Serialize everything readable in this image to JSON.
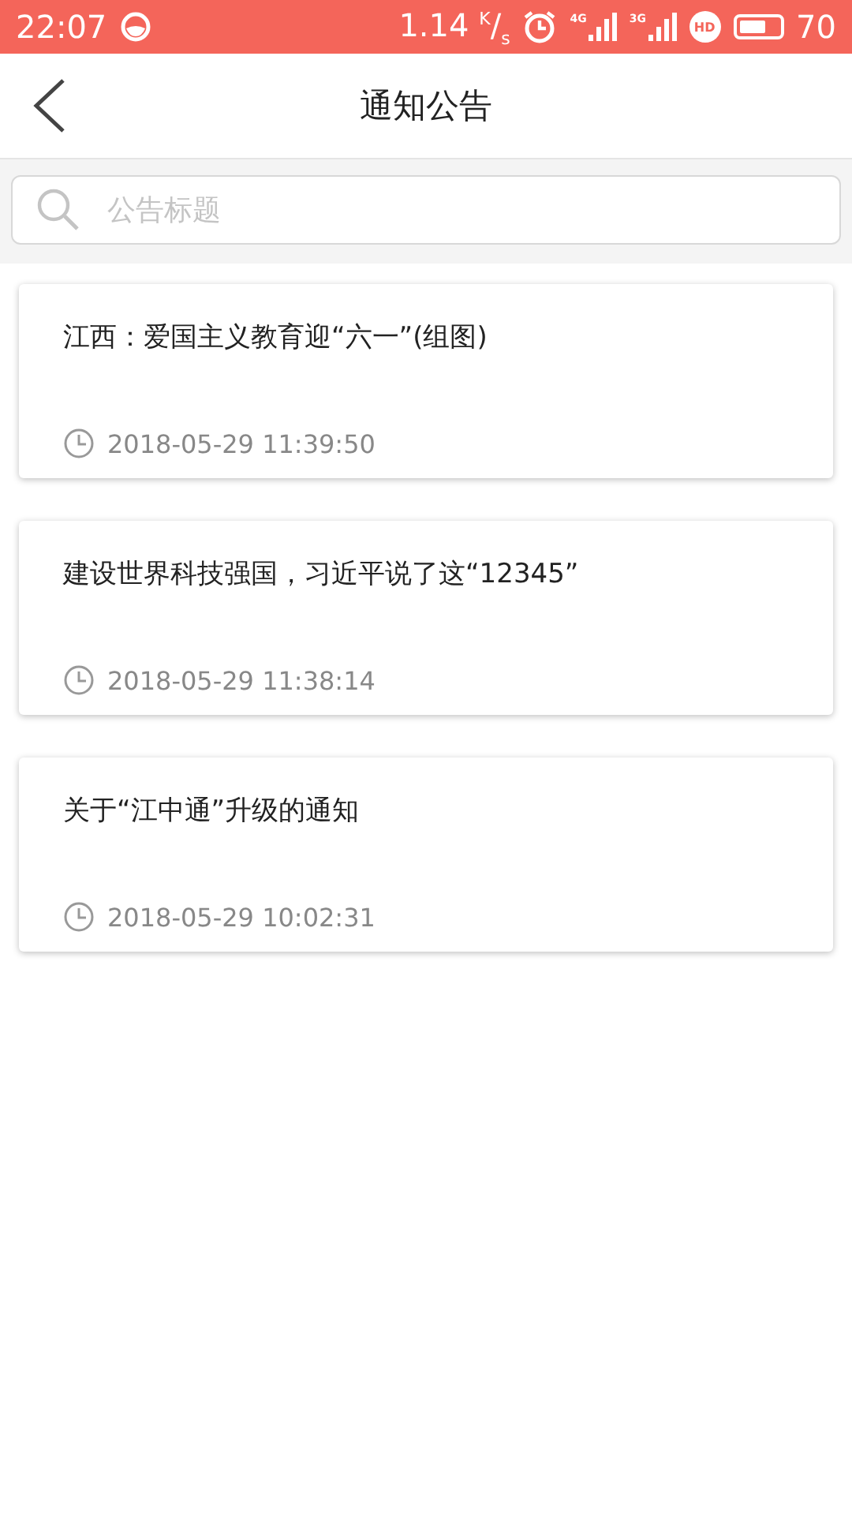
{
  "status_bar": {
    "time": "22:07",
    "speed": "1.14 $^{K}$/$_{s}$",
    "signals": [
      "4G",
      "3G"
    ],
    "hd": "HD",
    "battery": {
      "text": "70"
    }
  },
  "header": {
    "title": "通知公告"
  },
  "search": {
    "placeholder": "公告标题"
  },
  "notices": [
    {
      "title": "江西：爱国主义教育迎“六一”(组图)",
      "time": "2018-05-29 11:39:50"
    },
    {
      "title": "建设世界科技强国，习近平说了这“12345”",
      "time": "2018-05-29 11:38:14"
    },
    {
      "title": "关于“江中通”升级的通知",
      "time": "2018-05-29 10:02:31"
    }
  ]
}
